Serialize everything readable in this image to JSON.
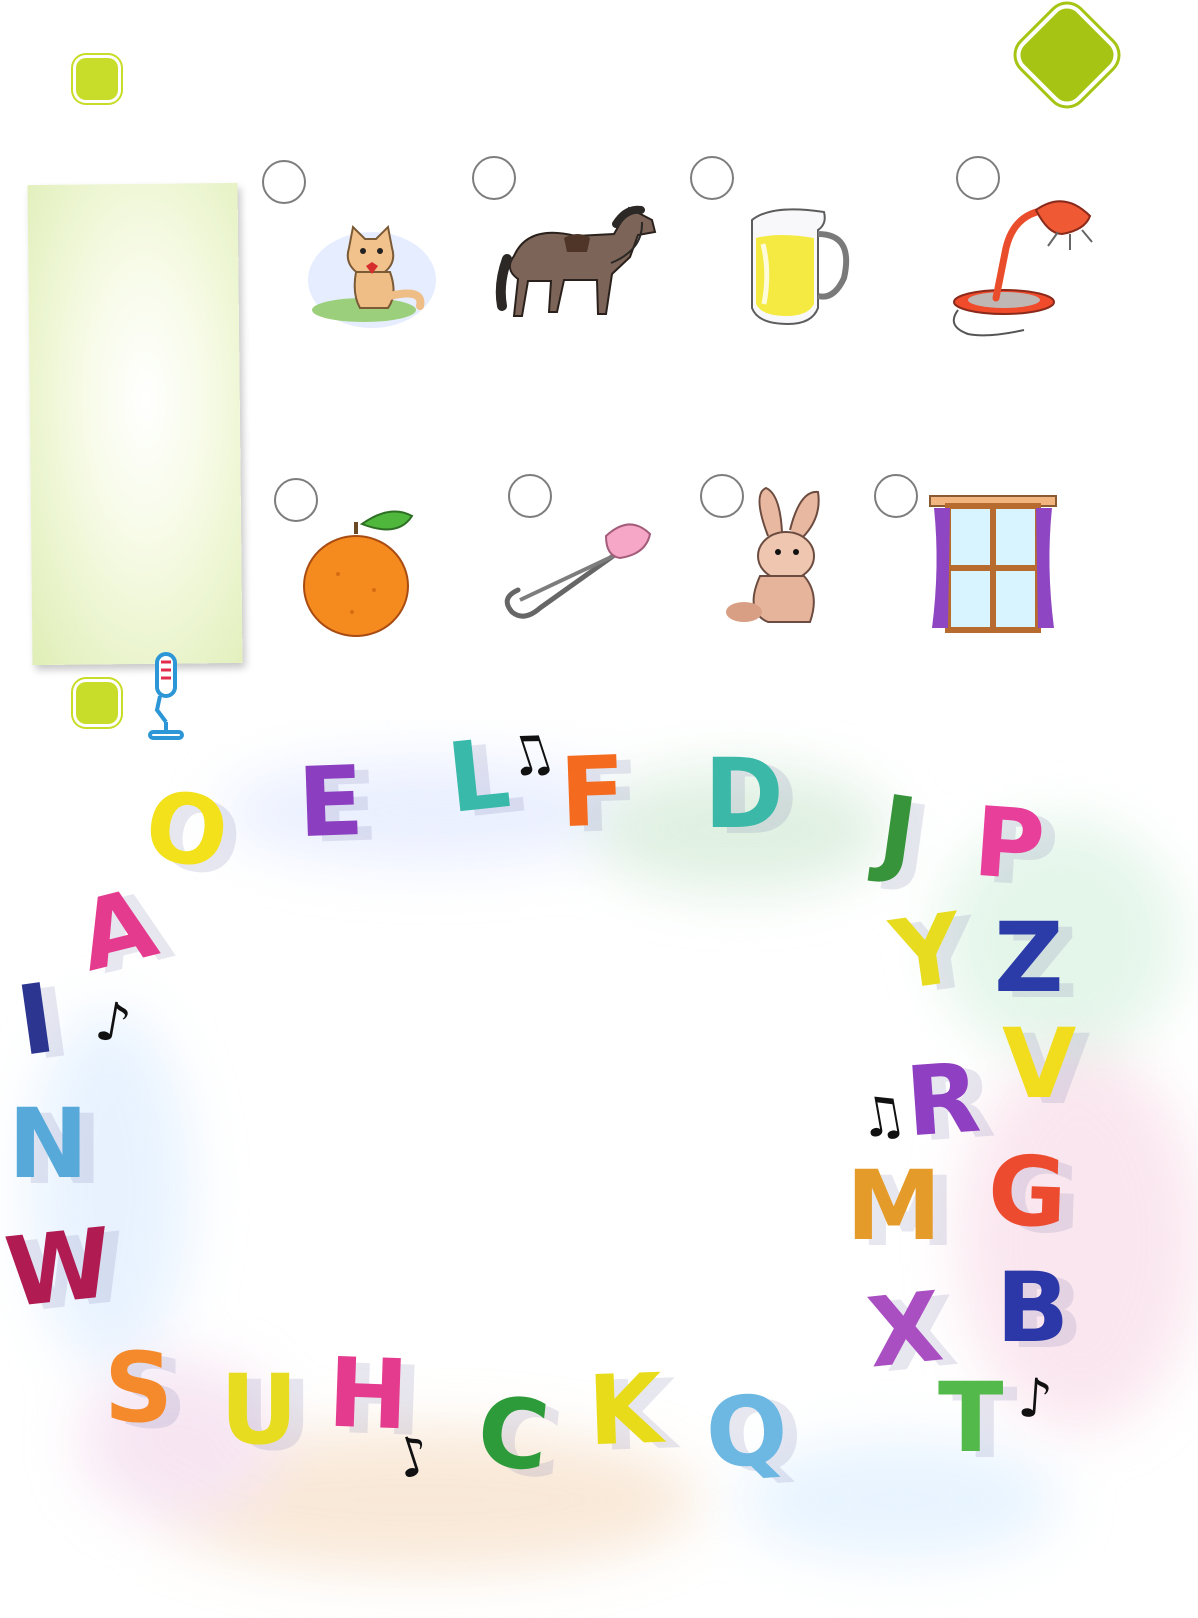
{
  "palette": {
    "accent_green": "#c8dc2a",
    "corner_green": "#a6c414",
    "paper_green": "#dfeeb6"
  },
  "icons": {
    "section_markers": [
      "green-rounded-square",
      "green-rounded-square"
    ],
    "corner_badge": "green-diamond",
    "recording": "microphone-icon",
    "answer_bubbles": 8
  },
  "pictures": {
    "row1": [
      "cat",
      "horse",
      "juice-jug",
      "desk-lamp"
    ],
    "row2": [
      "orange",
      "safety-pin",
      "rabbit",
      "window"
    ]
  },
  "letters": {
    "A": "#e53b8f",
    "O": "#f3e11b",
    "E": "#8b3fc0",
    "L": "#39b9a9",
    "F": "#f46b1f",
    "D": "#3bb8a8",
    "J": "#37943b",
    "P": "#e83f9b",
    "Y": "#e7dc1f",
    "Z": "#2b3ca8",
    "V": "#f1dd1d",
    "R": "#8f3fc1",
    "G": "#ed4b2f",
    "M": "#e49b2a",
    "B": "#2d38a8",
    "X": "#a94fc2",
    "T": "#53b94a",
    "Q": "#6db8e3",
    "K": "#e8dc1a",
    "C": "#2d9b39",
    "H": "#e53b8f",
    "U": "#e7dc1f",
    "S": "#f58a2c",
    "W": "#b01b52",
    "N": "#56a9d9",
    "I": "#2c3690"
  },
  "notes": [
    "music-note-icon",
    "music-note-icon",
    "music-note-icon",
    "music-note-icon",
    "music-note-icon"
  ]
}
